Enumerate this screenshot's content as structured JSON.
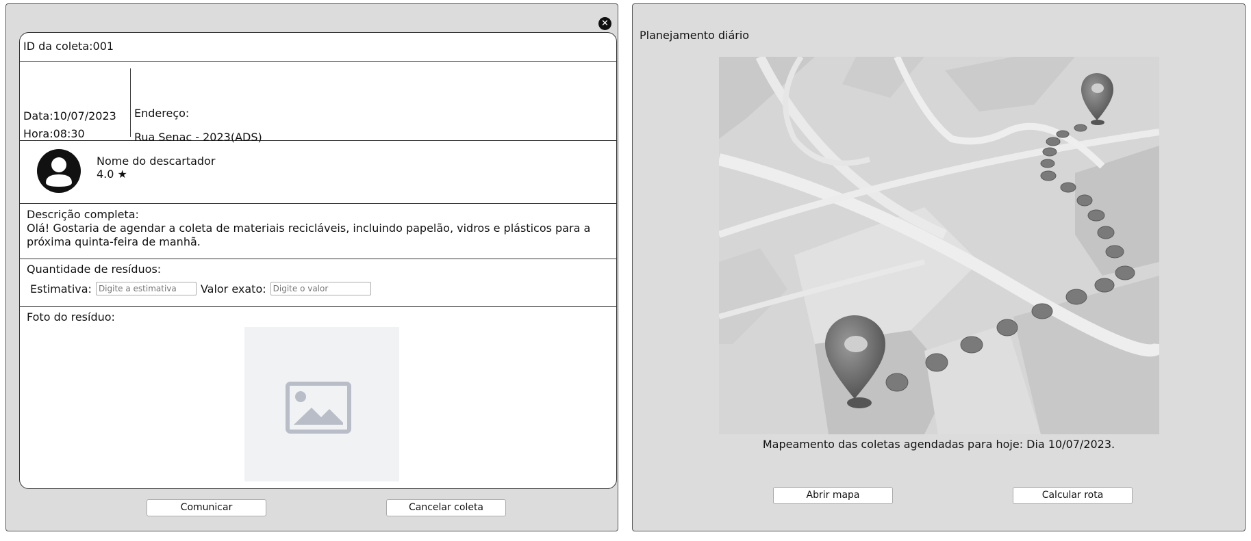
{
  "collection": {
    "id_label": "ID da coleta:001",
    "date": "Data:10/07/2023",
    "time": "Hora:08:30",
    "address_label": "Endereço:",
    "address_value": "Rua Senac - 2023(ADS)"
  },
  "user": {
    "name": "Nome do descartador",
    "rating": "4.0 ★",
    "avatar_icon": "user-avatar-icon"
  },
  "description": {
    "label": "Descrição completa:",
    "text": "Olá! Gostaria de agendar a coleta de materiais recicláveis, incluindo papelão, vidros e plásticos para a próxima quinta-feira de manhã."
  },
  "quantity": {
    "label": "Quantidade de resíduos:",
    "estimate_label": "Estimativa:",
    "estimate_placeholder": "Digite a estimativa",
    "exact_label": "Valor exato:",
    "exact_placeholder": "Digite o valor"
  },
  "photo": {
    "label": "Foto do resíduo:",
    "icon": "image-placeholder-icon"
  },
  "actions": {
    "close_icon": "close-icon",
    "communicate": "Comunicar",
    "cancel": "Cancelar coleta"
  },
  "planning": {
    "title": "Planejamento diário",
    "caption": "Mapeamento das coletas agendadas para hoje: Dia 10/07/2023.",
    "open_map": "Abrir mapa",
    "calculate_route": "Calcular rota"
  }
}
